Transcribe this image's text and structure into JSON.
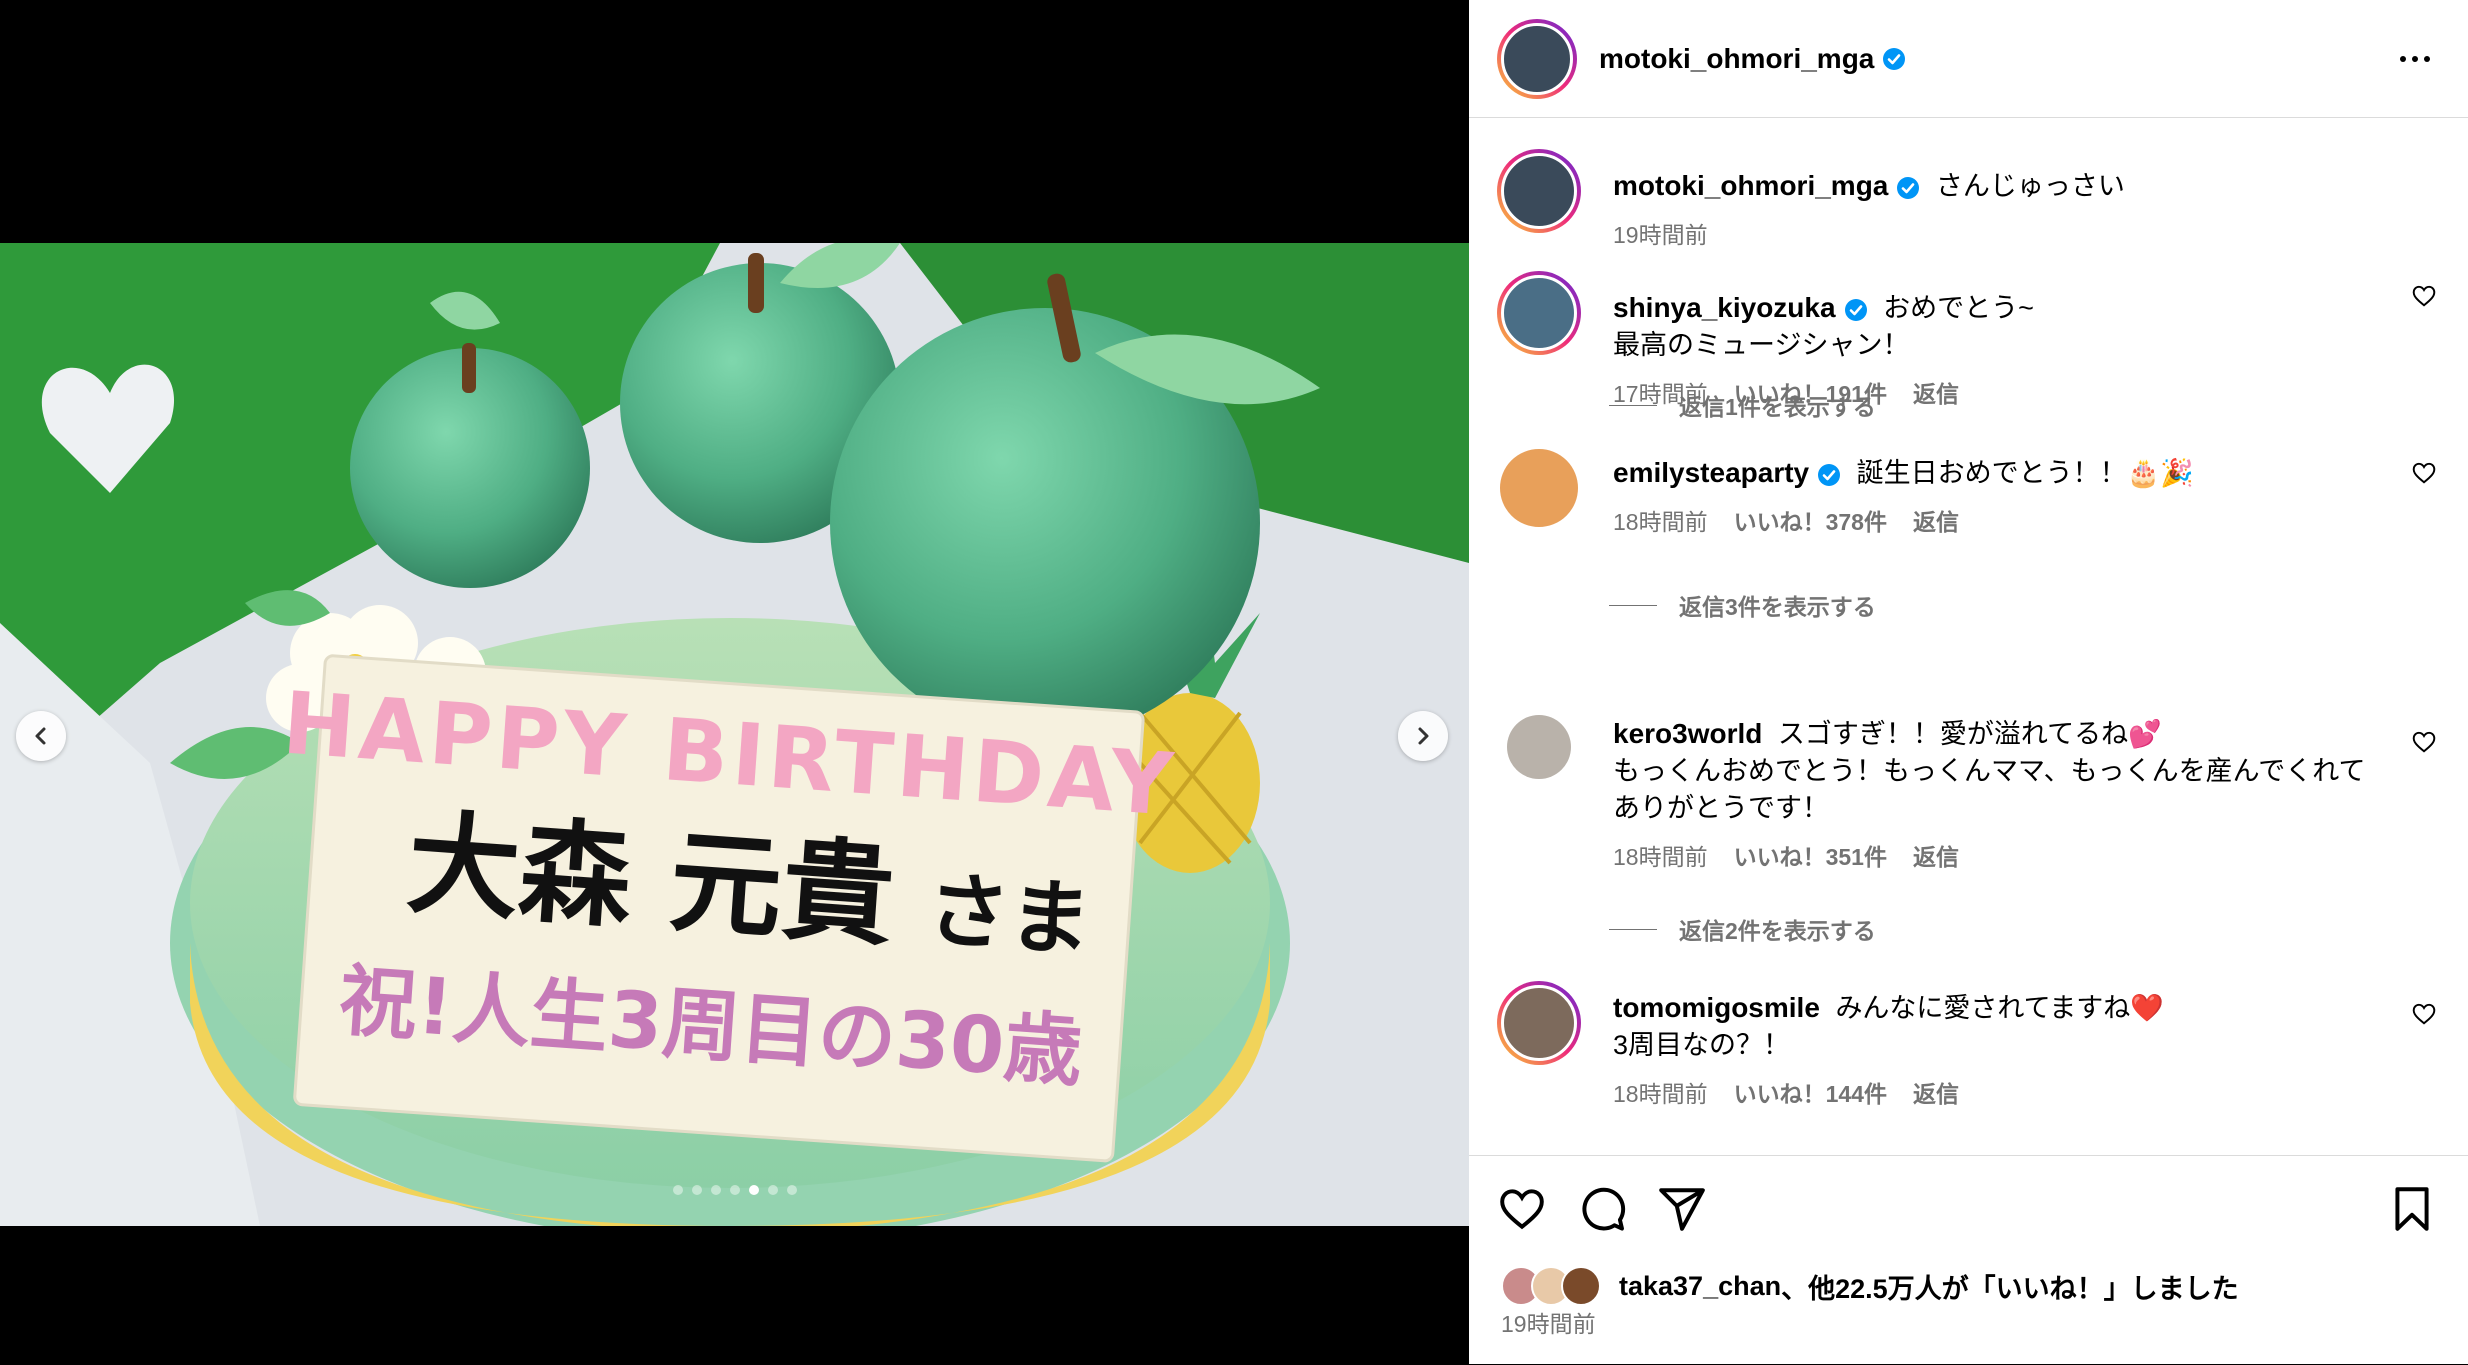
{
  "post": {
    "username": "motoki_ohmori_mga",
    "caption": "さんじゅっさい",
    "time": "19時間前"
  },
  "photo": {
    "cake_line1": "HAPPY BIRTHDAY",
    "cake_name": "大森 元貴",
    "cake_honorific": "さま",
    "cake_line3": "祝!人生3周目の30歳",
    "slide_count": 7,
    "active_slide": 5
  },
  "comments": [
    {
      "username": "shinya_kiyozuka",
      "verified": true,
      "text_line1": "おめでとう~",
      "text_line2": "最高のミュージシャン！",
      "time": "17時間前",
      "likes": "いいね！191件",
      "reply": "返信",
      "view_replies": "返信1件を表示する",
      "avatar_color": "#4a6e86"
    },
    {
      "username": "emilysteaparty",
      "verified": true,
      "text_line1": "誕生日おめでとう！！🎂🎉",
      "text_line2": "",
      "time": "18時間前",
      "likes": "いいね！378件",
      "reply": "返信",
      "view_replies": "返信3件を表示する",
      "avatar_color": "#e8a05a"
    },
    {
      "username": "kero3world",
      "verified": false,
      "text_line1": "スゴすぎ！！愛が溢れてるね💕",
      "text_line2": "もっくんおめでとう！もっくんママ、もっくんを産んでくれて",
      "text_line3": "ありがとうです！",
      "time": "18時間前",
      "likes": "いいね！351件",
      "reply": "返信",
      "view_replies": "返信2件を表示する",
      "avatar_color": "#b9b2aa"
    },
    {
      "username": "tomomigosmile",
      "verified": false,
      "text_line1": "みんなに愛されてますね❤️",
      "text_line2": "3周目なの？！",
      "time": "18時間前",
      "likes": "いいね！144件",
      "reply": "返信",
      "avatar_color": "#7d6a5c"
    }
  ],
  "footer": {
    "liked_by_user": "taka37_chan",
    "liked_by_rest": "、他22.5万人が「いいね！」しました",
    "time": "19時間前"
  },
  "colors": {
    "verified": "#0095f6",
    "muted": "#737373",
    "border": "#dbdbdb",
    "cake_green": "#5bb88a"
  },
  "icons": [
    "chevron-left-icon",
    "chevron-right-icon",
    "verified-icon",
    "more-icon",
    "heart-icon",
    "comment-icon",
    "share-icon",
    "bookmark-icon"
  ]
}
